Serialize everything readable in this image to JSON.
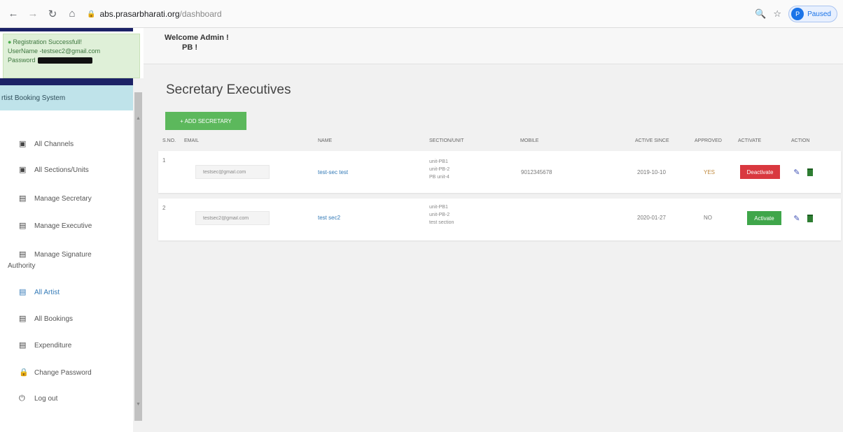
{
  "browser": {
    "url_host": "abs.prasarbharati.org",
    "url_path": "/dashboard",
    "profile_label": "Paused",
    "profile_initial": "P"
  },
  "alert": {
    "title": "Registration Successfull!",
    "username_line": "UserName -testsec2@gmail.com",
    "password_label": "Password"
  },
  "sidebar": {
    "brand": "rtist Booking System",
    "items": [
      {
        "label": "All Channels",
        "icon": "square-icon"
      },
      {
        "label": "All Sections/Units",
        "icon": "square-icon"
      },
      {
        "label": "Manage Secretary",
        "icon": "table-icon"
      },
      {
        "label": "Manage Executive",
        "icon": "table-icon"
      },
      {
        "label": "Manage Signature",
        "label2": "Authority",
        "icon": "table-icon"
      },
      {
        "label": "All Artist",
        "icon": "table-icon",
        "active": true
      },
      {
        "label": "All Bookings",
        "icon": "table-icon"
      },
      {
        "label": "Expenditure",
        "icon": "table-icon"
      },
      {
        "label": "Change Password",
        "icon": "lock-icon"
      },
      {
        "label": "Log out",
        "icon": "power-icon"
      }
    ]
  },
  "header": {
    "welcome": "Welcome Admin !",
    "sub": "PB !"
  },
  "main": {
    "title": "Secretary Executives",
    "add_button": "+ ADD SECRETARY",
    "columns": [
      "S.NO.",
      "EMAIL",
      "NAME",
      "SECTION/UNIT",
      "MOBILE",
      "ACTIVE SINCE",
      "APPROVED",
      "ACTIVATE",
      "ACTION"
    ],
    "rows": [
      {
        "sno": "1",
        "email": "testsec@gmail.com",
        "name": "test-sec test",
        "units": [
          "unit-PB1",
          "unit-PB-2",
          "PB unit-4"
        ],
        "mobile": "9012345678",
        "active_since": "2019-10-10",
        "approved": "YES",
        "activate_label": "Deactivate"
      },
      {
        "sno": "2",
        "email": "testsec2@gmail.com",
        "name": "test sec2",
        "units": [
          "unit-PB1",
          "unit-PB-2",
          "test section"
        ],
        "mobile": "",
        "active_since": "2020-01-27",
        "approved": "NO",
        "activate_label": "Activate"
      }
    ]
  },
  "colors": {
    "navy": "#1c2266",
    "success": "#5cb85c",
    "danger": "#d9383f",
    "link": "#337ab7"
  }
}
